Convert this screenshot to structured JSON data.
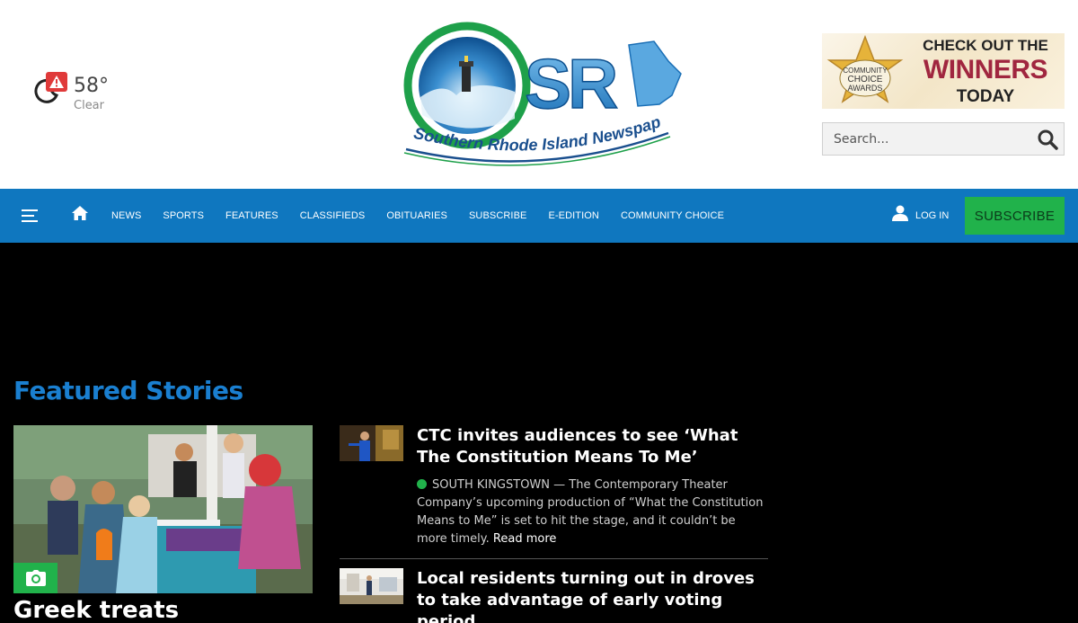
{
  "weather": {
    "temperature": "58°",
    "condition": "Clear",
    "icons": [
      "moon-icon",
      "alert-icon"
    ]
  },
  "logo": {
    "wordmark": "SRI",
    "tagline": "Southern Rhode Island Newspapers"
  },
  "promo": {
    "badge_lines": [
      "COMMUNITY",
      "CHOICE",
      "AWARDS"
    ],
    "line1": "CHECK OUT THE",
    "line2": "WINNERS",
    "line3": "TODAY"
  },
  "search": {
    "placeholder": "Search..."
  },
  "nav": {
    "items": [
      "NEWS",
      "SPORTS",
      "FEATURES",
      "CLASSIFIEDS",
      "OBITUARIES",
      "SUBSCRIBE",
      "E-EDITION",
      "COMMUNITY CHOICE"
    ],
    "login": "LOG IN",
    "subscribe": "SUBSCRIBE"
  },
  "featured": {
    "title": "Featured Stories",
    "lead": {
      "headline": "Greek treats"
    },
    "stories": [
      {
        "headline": "CTC invites audiences to see ‘What The Constitution Means To Me’",
        "dateline": "SOUTH KINGSTOWN",
        "summary": " — The Contemporary Theater Company’s upcoming production of “What the Constitution Means to Me” is set to hit the stage, and it couldn’t be more timely.",
        "read_more": "Read more"
      },
      {
        "headline": "Local residents turning out in droves to take advantage of early voting period"
      }
    ]
  },
  "colors": {
    "nav_blue": "#0f77bf",
    "subscribe_green": "#21b24b",
    "section_title_blue": "#1a7fd0",
    "promo_red": "#a0263f"
  }
}
